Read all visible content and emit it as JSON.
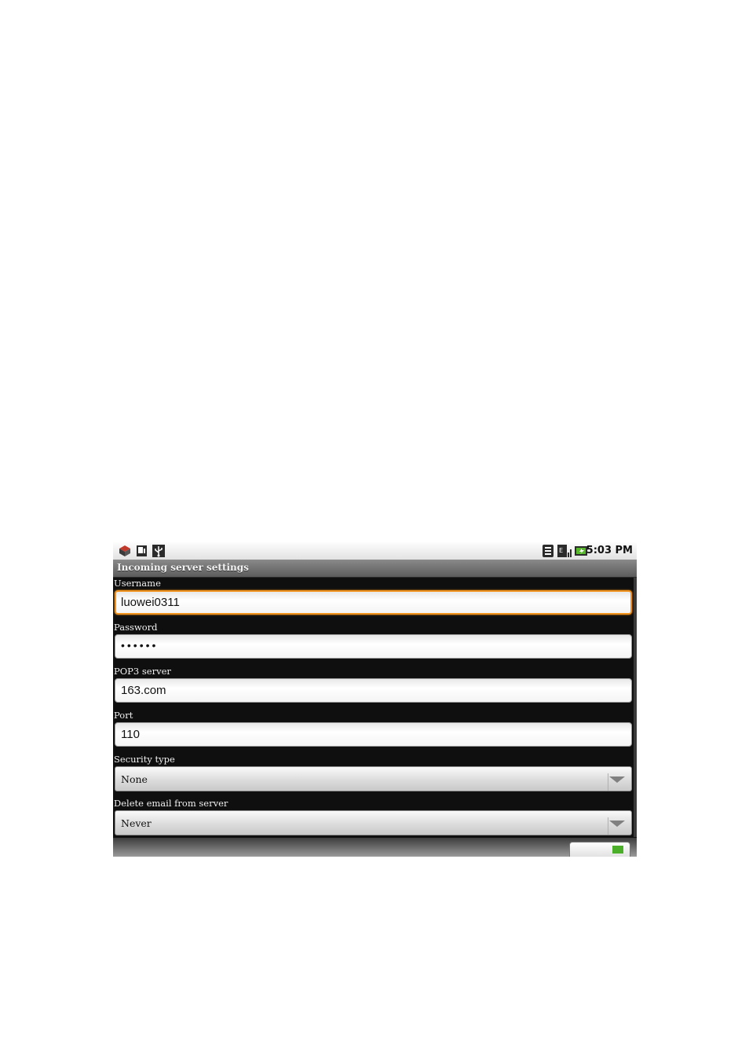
{
  "status_bar": {
    "time": "5:03 PM",
    "left_icons": [
      "app-notification-icon",
      "sd-card-icon",
      "usb-icon"
    ],
    "right_icons": [
      "wifi-icon",
      "signal-icon",
      "battery-icon"
    ]
  },
  "title": "Incoming server settings",
  "form": {
    "username": {
      "label": "Username",
      "value": "luowei0311"
    },
    "password": {
      "label": "Password",
      "value": "••••••"
    },
    "pop3_server": {
      "label": "POP3 server",
      "value": "163.com"
    },
    "port": {
      "label": "Port",
      "value": "110"
    },
    "security_type": {
      "label": "Security type",
      "selected": "None"
    },
    "delete_email": {
      "label": "Delete email from server",
      "selected": "Never"
    }
  },
  "colors": {
    "focus_border": "#f0921c",
    "background": "#0f0f0f"
  }
}
